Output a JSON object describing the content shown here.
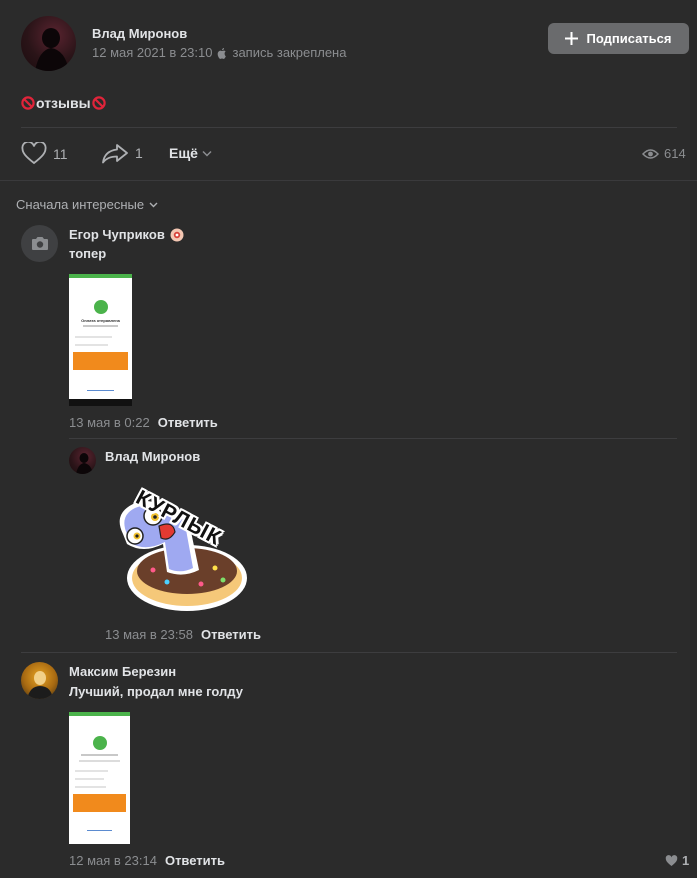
{
  "post": {
    "author": "Влад Миронов",
    "meta": "12 мая 2021 в 23:10",
    "pinned": "запись закреплена",
    "subscribe_label": "Подписаться",
    "text": "отзывы",
    "likes": "11",
    "shares": "1",
    "more_label": "Ещё",
    "views": "614"
  },
  "comments_sort": "Сначала интересные",
  "comments": [
    {
      "author": "Егор Чуприков",
      "text": "топер",
      "date": "13 мая в 0:22",
      "reply_label": "Ответить",
      "screenshot_texts": [
        "Оплата отправлена"
      ]
    },
    {
      "author": "Влад Миронов",
      "sticker_text": "КУРЛЫК",
      "date": "13 мая в 23:58",
      "reply_label": "Ответить"
    },
    {
      "author": "Максим Березин",
      "text": "Лучший, продал мне голду",
      "date": "12 мая в 23:14",
      "reply_label": "Ответить",
      "likes": "1"
    }
  ],
  "colors": {
    "background": "#2b2b2b",
    "button": "#6a6b6d",
    "muted": "#8b8d90",
    "text": "#e1e3e6",
    "success_green": "#4bb34b",
    "banner_orange": "#f18a1c"
  }
}
